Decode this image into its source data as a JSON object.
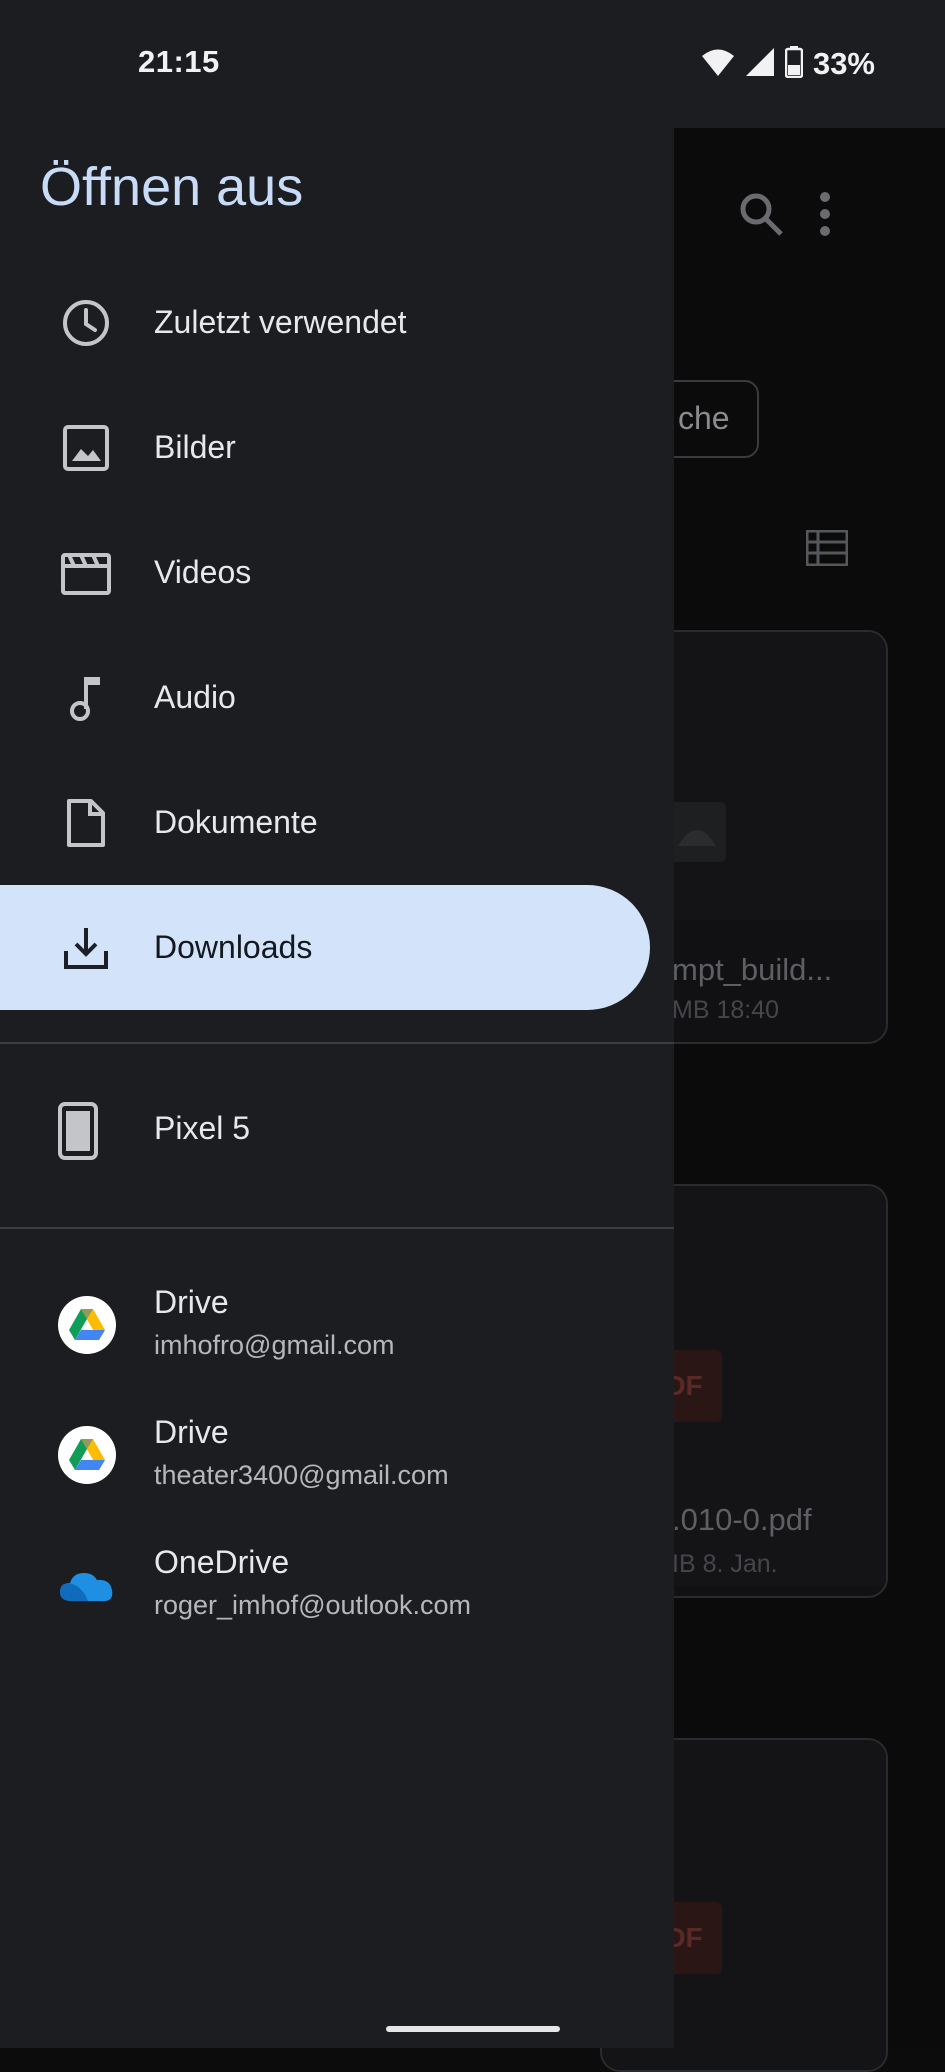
{
  "status_bar": {
    "time": "21:15",
    "battery": "33%"
  },
  "drawer": {
    "title": "Öffnen aus",
    "items": [
      {
        "label": "Zuletzt verwendet",
        "icon": "clock-icon"
      },
      {
        "label": "Bilder",
        "icon": "image-icon"
      },
      {
        "label": "Videos",
        "icon": "video-icon"
      },
      {
        "label": "Audio",
        "icon": "music-note-icon"
      },
      {
        "label": "Dokumente",
        "icon": "document-icon"
      },
      {
        "label": "Downloads",
        "icon": "download-icon",
        "selected": true
      }
    ],
    "device": {
      "label": "Pixel 5",
      "icon": "phone-icon"
    },
    "accounts": [
      {
        "title": "Drive",
        "subtitle": "imhofro@gmail.com",
        "icon": "google-drive-icon"
      },
      {
        "title": "Drive",
        "subtitle": "theater3400@gmail.com",
        "icon": "google-drive-icon"
      },
      {
        "title": "OneDrive",
        "subtitle": "roger_imhof@outlook.com",
        "icon": "onedrive-icon"
      }
    ]
  },
  "background": {
    "chip_text": "che",
    "cards": [
      {
        "name": "mpt_build...",
        "meta": "MB 18:40"
      },
      {
        "name": ".010-0.pdf",
        "meta": "IB 8. Jan."
      }
    ],
    "pdf_label": "DF"
  },
  "colors": {
    "drawer_bg": "#1c1d20",
    "accent": "#d3e3fa",
    "title": "#c8dcf8"
  }
}
